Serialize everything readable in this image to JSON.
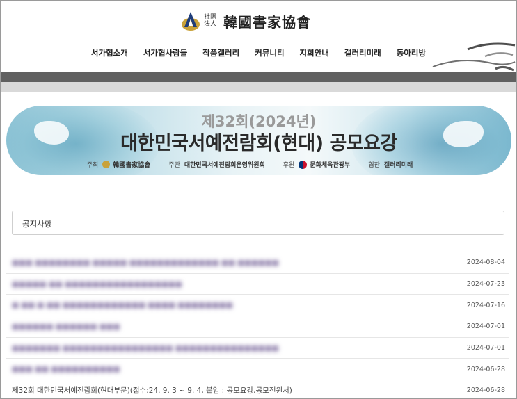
{
  "header": {
    "logo_small": "社團法人",
    "logo_text": "韓國書家協會",
    "nav": [
      "서가협소개",
      "서가협사람들",
      "작품갤러리",
      "커뮤니티",
      "지회안내",
      "갤러리미래",
      "동아리방"
    ]
  },
  "banner": {
    "subtitle": "제32회(2024년)",
    "title": "대한민국서예전람회(현대) 공모요강",
    "credits": [
      {
        "label": "주최",
        "value": "韓國書家協會"
      },
      {
        "label": "주관",
        "value": "대한민국서예전람회운영위원회"
      },
      {
        "label": "후원",
        "value": "문화체육관광부"
      },
      {
        "label": "협찬",
        "value": "갤러리미래"
      }
    ]
  },
  "search": {
    "value": "공지사항"
  },
  "notices": [
    {
      "title": "",
      "date": "2024-08-04"
    },
    {
      "title": "",
      "date": "2024-07-23"
    },
    {
      "title": "",
      "date": "2024-07-16"
    },
    {
      "title": "",
      "date": "2024-07-01"
    },
    {
      "title": "",
      "date": "2024-07-01"
    },
    {
      "title": "",
      "date": "2024-06-28"
    },
    {
      "title": "제32회 대한민국서예전람회(현대부문)(접수:24. 9. 3 ~ 9. 4, 붙임 : 공모요강,공모전원서)",
      "date": "2024-06-28"
    }
  ]
}
